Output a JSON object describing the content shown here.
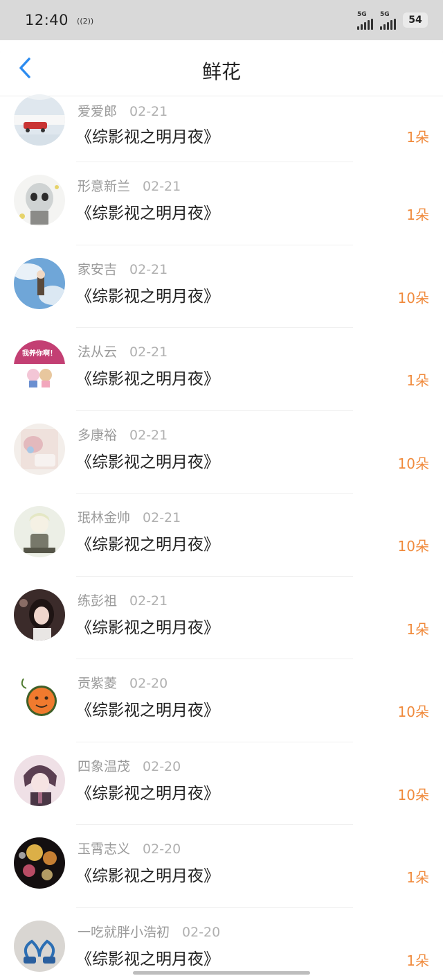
{
  "status": {
    "time": "12:40",
    "hotspot": "((2))",
    "sim1": "5G",
    "sim2": "5G",
    "battery": "54"
  },
  "nav": {
    "title": "鲜花"
  },
  "colors": {
    "accent": "#f08a3c",
    "back": "#2d8cf0"
  },
  "rows": [
    {
      "user": "爱爱郎",
      "date": "02-21",
      "book": "《综影视之明月夜》",
      "amount": "1朵"
    },
    {
      "user": "形意新兰",
      "date": "02-21",
      "book": "《综影视之明月夜》",
      "amount": "1朵"
    },
    {
      "user": "家安吉",
      "date": "02-21",
      "book": "《综影视之明月夜》",
      "amount": "10朵"
    },
    {
      "user": "法从云",
      "date": "02-21",
      "book": "《综影视之明月夜》",
      "amount": "1朵",
      "avatar_text": "我养你啊！"
    },
    {
      "user": "多康裕",
      "date": "02-21",
      "book": "《综影视之明月夜》",
      "amount": "10朵"
    },
    {
      "user": "珉林金帅",
      "date": "02-21",
      "book": "《综影视之明月夜》",
      "amount": "10朵"
    },
    {
      "user": "练彭祖",
      "date": "02-21",
      "book": "《综影视之明月夜》",
      "amount": "1朵"
    },
    {
      "user": "贡紫菱",
      "date": "02-20",
      "book": "《综影视之明月夜》",
      "amount": "10朵"
    },
    {
      "user": "四象温茂",
      "date": "02-20",
      "book": "《综影视之明月夜》",
      "amount": "10朵"
    },
    {
      "user": "玉霄志义",
      "date": "02-20",
      "book": "《综影视之明月夜》",
      "amount": "1朵"
    },
    {
      "user": "一吃就胖小浩初",
      "date": "02-20",
      "book": "《综影视之明月夜》",
      "amount": "1朵"
    }
  ]
}
